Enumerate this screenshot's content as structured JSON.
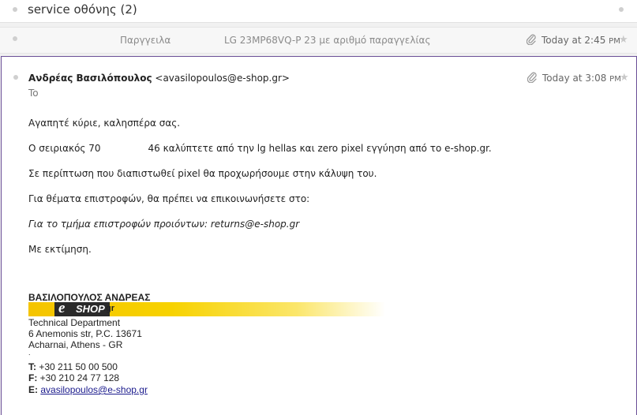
{
  "thread": {
    "subject": "service οθόνης (2)"
  },
  "messages": {
    "collapsed": {
      "sender": "Παργγειλα",
      "snippet": "LG 23MP68VQ-P 23 με αριθμό παραγγελίας",
      "date": "Today at 2:45",
      "date_suffix": "PM",
      "star": "★"
    },
    "expanded": {
      "from_name": "Ανδρέας Βασιλόπουλος",
      "from_email": "<avasilopoulos@e-shop.gr>",
      "to_label": "To",
      "date": "Today at 3:08",
      "date_suffix": "PM",
      "star": "★",
      "body": {
        "greeting": "Αγαπητέ κύριε, καλησπέρα σας.",
        "serial_start": "Ο σειριακός 70",
        "serial_end": "46 καλύπτετε  από την lg hellas και zero pixel εγγύηση  από το e-shop.gr.",
        "line3": "Σε περίπτωση που διαπιστωθεί pixel θα προχωρήσουμε στην κάλυψη του.",
        "line4": "Για θέματα επιστροφών, θα πρέπει να επικοινωνήσετε στο:",
        "line5": "Για το τμήμα επιστροφών προιόντων: returns@e-shop.gr",
        "closing": "Με εκτίμηση."
      },
      "signature": {
        "name": "ΒΑΣΙΛΟΠΟΥΛΟΣ ΑΝΔΡΕΑΣ",
        "logo_e": "e",
        "logo_shop": "SHOP",
        "logo_gr": ".gr",
        "department": "Technical Department",
        "address1": "6 Anemonis str, P.C. 13671",
        "address2": "Acharnai, Athens - GR",
        "dot": ".",
        "phone_label": "T:",
        "phone": "+30 211 50 00 500",
        "fax_label": "F:",
        "fax": "+30 210 24 77 128",
        "email_label": "E:",
        "email": "avasilopoulos@e-shop.gr"
      }
    }
  },
  "colors": {
    "selected_border": "#6a4f97",
    "logo_yellow": "#f5c400",
    "link": "#1a1a8c"
  }
}
